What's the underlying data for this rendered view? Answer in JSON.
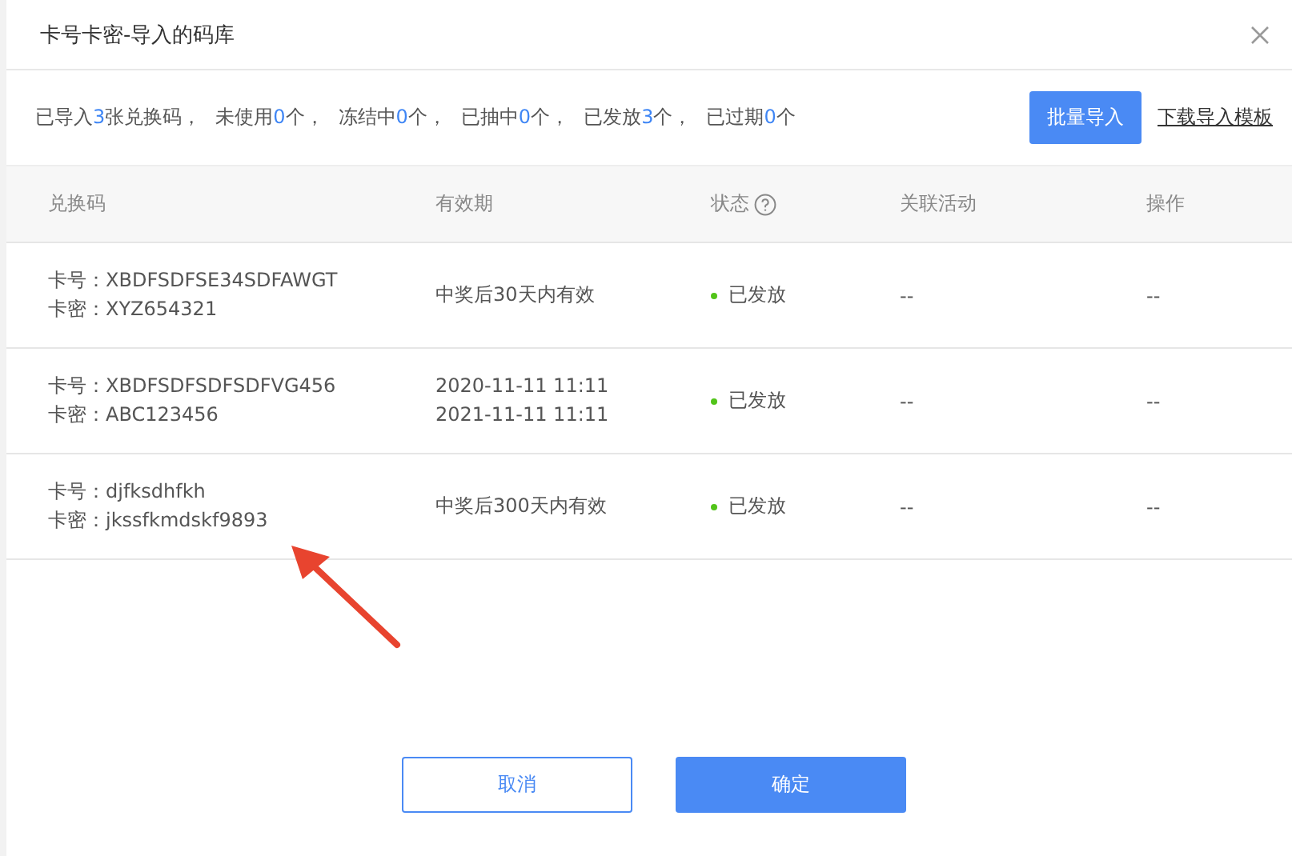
{
  "dialog": {
    "title": "卡号卡密-导入的码库"
  },
  "summary": [
    {
      "before": "已导入",
      "count": "3",
      "after": "张兑换码，"
    },
    {
      "before": "未使用",
      "count": "0",
      "after": "个，"
    },
    {
      "before": "冻结中",
      "count": "0",
      "after": "个，"
    },
    {
      "before": "已抽中",
      "count": "0",
      "after": "个，"
    },
    {
      "before": "已发放",
      "count": "3",
      "after": "个，"
    },
    {
      "before": "已过期",
      "count": "0",
      "after": "个"
    }
  ],
  "actions": {
    "import_button": "批量导入",
    "template_link": "下载导入模板"
  },
  "table": {
    "columns": [
      "兑换码",
      "有效期",
      "状态",
      "关联活动",
      "操作"
    ],
    "rows": [
      {
        "code": [
          "卡号：XBDFSDFSE34SDFAWGT",
          "卡密：XYZ654321"
        ],
        "validity": [
          "中奖后30天内有效"
        ],
        "status": "已发放",
        "activity": "--",
        "operation": "--"
      },
      {
        "code": [
          "卡号：XBDFSDFSDFSDFVG456",
          "卡密：ABC123456"
        ],
        "validity": [
          "2020-11-11 11:11",
          "2021-11-11 11:11"
        ],
        "status": "已发放",
        "activity": "--",
        "operation": "--"
      },
      {
        "code": [
          "卡号：djfksdhfkh",
          "卡密：jkssfkmdskf9893"
        ],
        "validity": [
          "中奖后300天内有效"
        ],
        "status": "已发放",
        "activity": "--",
        "operation": "--"
      }
    ]
  },
  "footer": {
    "cancel": "取消",
    "confirm": "确定"
  }
}
